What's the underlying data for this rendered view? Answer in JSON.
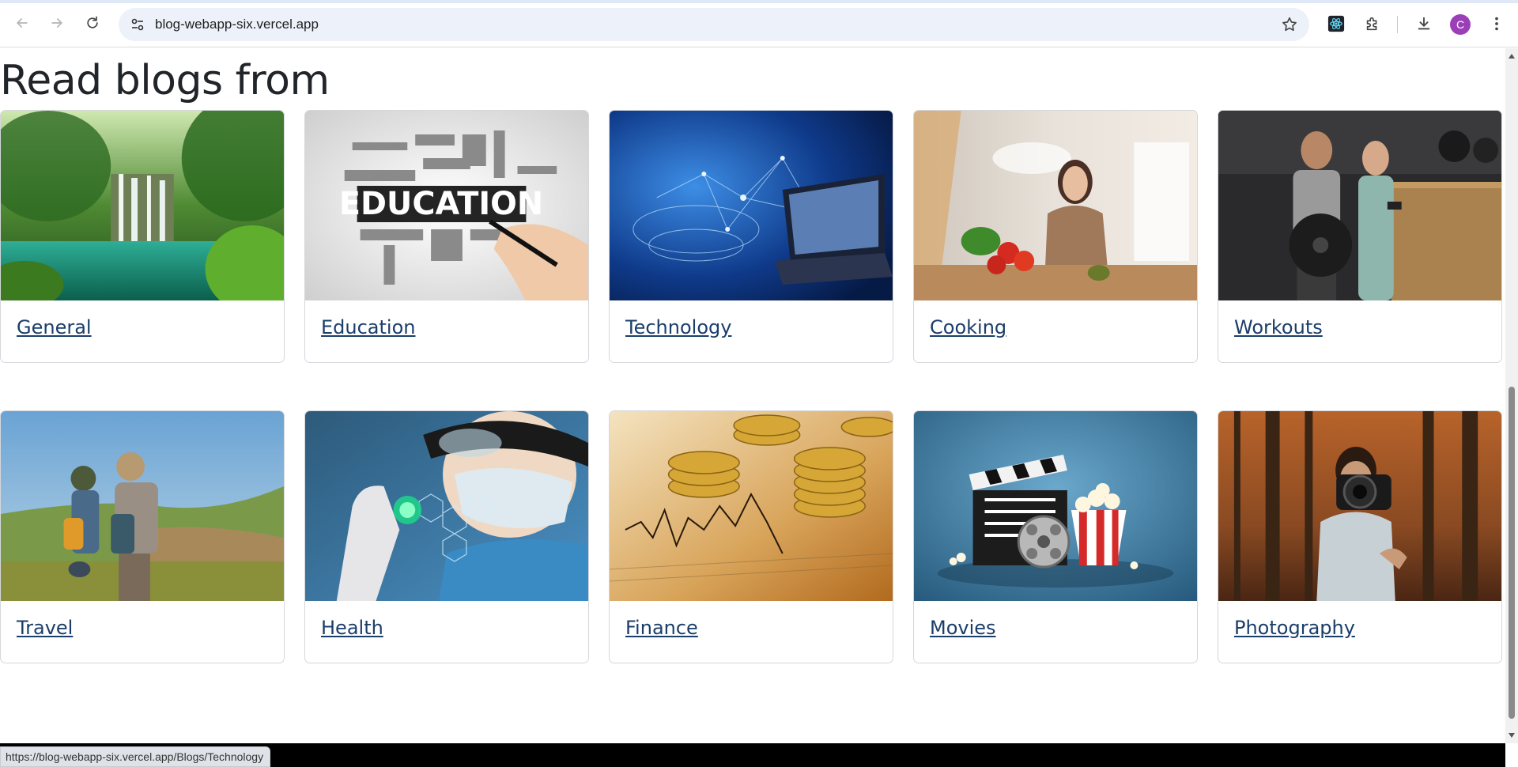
{
  "browser": {
    "url": "blog-webapp-six.vercel.app",
    "profile_initial": "C",
    "status_url": "https://blog-webapp-six.vercel.app/Blogs/Technology"
  },
  "page": {
    "title": "Read blogs from"
  },
  "categories": [
    {
      "label": "General",
      "image": "waterfall-forest"
    },
    {
      "label": "Education",
      "image": "education-word-cloud"
    },
    {
      "label": "Technology",
      "image": "laptop-network"
    },
    {
      "label": "Cooking",
      "image": "woman-cooking"
    },
    {
      "label": "Workouts",
      "image": "couple-fitness"
    },
    {
      "label": "Travel",
      "image": "kids-binoculars"
    },
    {
      "label": "Health",
      "image": "medical-hexagons"
    },
    {
      "label": "Finance",
      "image": "gold-coins-chart"
    },
    {
      "label": "Movies",
      "image": "clapperboard-popcorn"
    },
    {
      "label": "Photography",
      "image": "photographer-camera"
    }
  ],
  "image_text": {
    "education_word": "EDUCATION"
  },
  "colors": {
    "link": "#1a3e6a",
    "avatar": "#9b3fb8",
    "omnibox": "#edf2fa"
  }
}
